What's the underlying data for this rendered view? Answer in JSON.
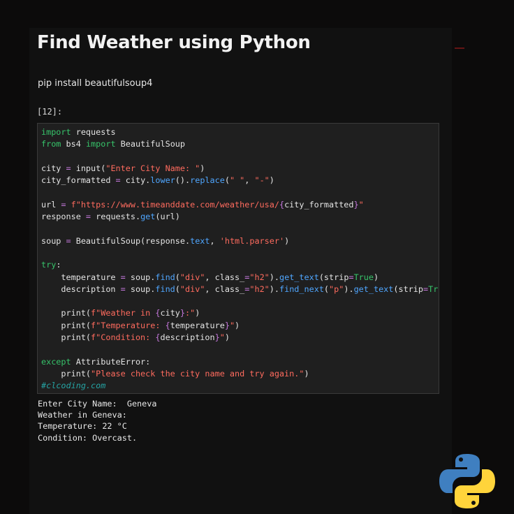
{
  "title": "Find Weather using Python",
  "install_command": "pip install beautifulsoup4",
  "cell_prompt": "[12]:",
  "code_lines": [
    [
      [
        "import",
        "kw"
      ],
      [
        " requests",
        ""
      ]
    ],
    [
      [
        "from",
        "kw"
      ],
      [
        " bs4 ",
        ""
      ],
      [
        "import",
        "kw"
      ],
      [
        " BeautifulSoup",
        ""
      ]
    ],
    [],
    [
      [
        "city ",
        ""
      ],
      [
        "=",
        "op"
      ],
      [
        " input(",
        ""
      ],
      [
        "\"Enter City Name: \"",
        "str"
      ],
      [
        ")",
        ""
      ]
    ],
    [
      [
        "city_formatted ",
        ""
      ],
      [
        "=",
        "op"
      ],
      [
        " city.",
        ""
      ],
      [
        "lower",
        "fn"
      ],
      [
        "().",
        ""
      ],
      [
        "replace",
        "fn"
      ],
      [
        "(",
        ""
      ],
      [
        "\" \"",
        "str"
      ],
      [
        ", ",
        ""
      ],
      [
        "\"-\"",
        "str"
      ],
      [
        ")",
        ""
      ]
    ],
    [],
    [
      [
        "url ",
        ""
      ],
      [
        "=",
        "op"
      ],
      [
        " ",
        ""
      ],
      [
        "f\"https://www.timeanddate.com/weather/usa/",
        "str"
      ],
      [
        "{",
        "op"
      ],
      [
        "city_formatted",
        ""
      ],
      [
        "}",
        "op"
      ],
      [
        "\"",
        "str"
      ]
    ],
    [
      [
        "response ",
        ""
      ],
      [
        "=",
        "op"
      ],
      [
        " requests.",
        ""
      ],
      [
        "get",
        "fn"
      ],
      [
        "(url)",
        ""
      ]
    ],
    [],
    [
      [
        "soup ",
        ""
      ],
      [
        "=",
        "op"
      ],
      [
        " BeautifulSoup(response.",
        ""
      ],
      [
        "text",
        "fn"
      ],
      [
        ", ",
        ""
      ],
      [
        "'html.parser'",
        "str"
      ],
      [
        ")",
        ""
      ]
    ],
    [],
    [
      [
        "try",
        "kw"
      ],
      [
        ":",
        ""
      ]
    ],
    [
      [
        "    temperature ",
        ""
      ],
      [
        "=",
        "op"
      ],
      [
        " soup.",
        ""
      ],
      [
        "find",
        "fn"
      ],
      [
        "(",
        ""
      ],
      [
        "\"div\"",
        "str"
      ],
      [
        ", class_",
        ""
      ],
      [
        "=",
        "op"
      ],
      [
        "\"h2\"",
        "str"
      ],
      [
        ").",
        ""
      ],
      [
        "get_text",
        "fn"
      ],
      [
        "(strip",
        ""
      ],
      [
        "=",
        "op"
      ],
      [
        "True",
        "kw"
      ],
      [
        ")",
        ""
      ]
    ],
    [
      [
        "    description ",
        ""
      ],
      [
        "=",
        "op"
      ],
      [
        " soup.",
        ""
      ],
      [
        "find",
        "fn"
      ],
      [
        "(",
        ""
      ],
      [
        "\"div\"",
        "str"
      ],
      [
        ", class_",
        ""
      ],
      [
        "=",
        "op"
      ],
      [
        "\"h2\"",
        "str"
      ],
      [
        ").",
        ""
      ],
      [
        "find_next",
        "fn"
      ],
      [
        "(",
        ""
      ],
      [
        "\"p\"",
        "str"
      ],
      [
        ").",
        ""
      ],
      [
        "get_text",
        "fn"
      ],
      [
        "(strip",
        ""
      ],
      [
        "=",
        "op"
      ],
      [
        "True",
        "kw"
      ],
      [
        ")",
        ""
      ]
    ],
    [],
    [
      [
        "    print(",
        ""
      ],
      [
        "f\"Weather in ",
        "str"
      ],
      [
        "{",
        "op"
      ],
      [
        "city",
        ""
      ],
      [
        "}",
        "op"
      ],
      [
        ":\"",
        "str"
      ],
      [
        ")",
        ""
      ]
    ],
    [
      [
        "    print(",
        ""
      ],
      [
        "f\"Temperature: ",
        "str"
      ],
      [
        "{",
        "op"
      ],
      [
        "temperature",
        ""
      ],
      [
        "}",
        "op"
      ],
      [
        "\"",
        "str"
      ],
      [
        ")",
        ""
      ]
    ],
    [
      [
        "    print(",
        ""
      ],
      [
        "f\"Condition: ",
        "str"
      ],
      [
        "{",
        "op"
      ],
      [
        "description",
        ""
      ],
      [
        "}",
        "op"
      ],
      [
        "\"",
        "str"
      ],
      [
        ")",
        ""
      ]
    ],
    [],
    [
      [
        "except",
        "kw"
      ],
      [
        " AttributeError:",
        ""
      ]
    ],
    [
      [
        "    print(",
        ""
      ],
      [
        "\"Please check the city name and try again.\"",
        "str"
      ],
      [
        ")",
        ""
      ]
    ],
    [
      [
        "#clcoding.com",
        "com"
      ]
    ]
  ],
  "output_lines": [
    "Enter City Name:  Geneva",
    "Weather in Geneva:",
    "Temperature: 22 °C",
    "Condition: Overcast."
  ],
  "colors": {
    "keyword": "#36c46a",
    "string": "#ff6b5e",
    "function": "#4fa6ff",
    "operator": "#c678dd",
    "comment": "#25a3a3",
    "logo_blue": "#3f7fc0",
    "logo_yellow": "#ffd43b"
  },
  "icons": {
    "logo": "python-logo-icon"
  }
}
